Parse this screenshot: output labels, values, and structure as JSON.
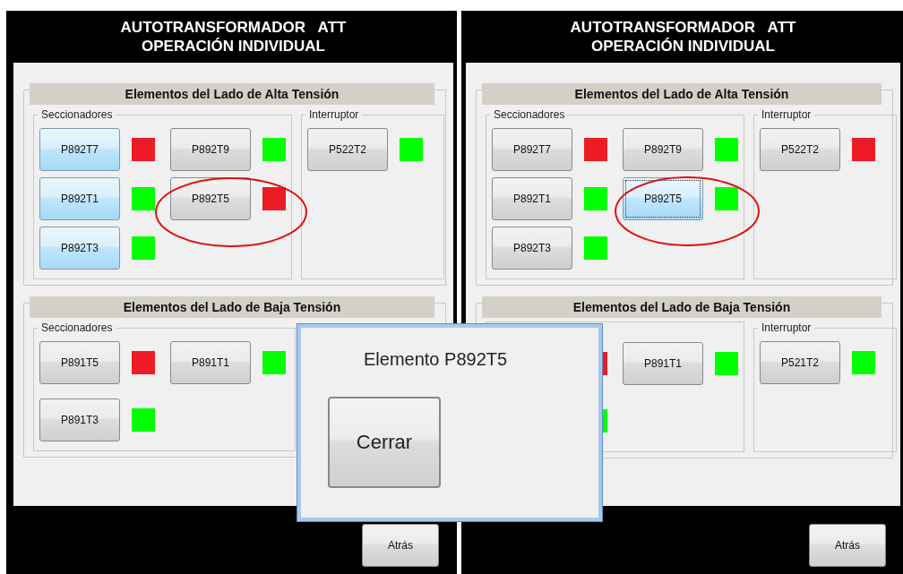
{
  "panels": [
    {
      "title_lines": [
        "AUTOTRANSFORMADOR   ATT",
        "OPERACIÓN INDIVIDUAL"
      ],
      "sections": [
        {
          "heading": "Elementos del Lado de Alta Tensión",
          "groups": [
            {
              "label": "Seccionadores",
              "items": [
                {
                  "label": "P892T7",
                  "highlighted": true,
                  "focused": false,
                  "color": "#ed1c24"
                },
                {
                  "label": "P892T9",
                  "highlighted": false,
                  "focused": false,
                  "color": "#00ff00"
                },
                {
                  "label": "P892T1",
                  "highlighted": true,
                  "focused": false,
                  "color": "#00ff00"
                },
                {
                  "label": "P892T5",
                  "highlighted": false,
                  "focused": false,
                  "color": "#ed1c24"
                },
                {
                  "label": "P892T3",
                  "highlighted": true,
                  "focused": false,
                  "color": "#00ff00"
                }
              ]
            },
            {
              "label": "Interruptor",
              "items": [
                {
                  "label": "P522T2",
                  "highlighted": false,
                  "focused": false,
                  "color": "#00ff00"
                }
              ]
            }
          ]
        },
        {
          "heading": "Elementos del Lado de Baja Tensión",
          "groups": [
            {
              "label": "Seccionadores",
              "items": [
                {
                  "label": "P891T5",
                  "highlighted": false,
                  "focused": false,
                  "color": "#ed1c24"
                },
                {
                  "label": "P891T1",
                  "highlighted": false,
                  "focused": false,
                  "color": "#00ff00"
                },
                {
                  "label": "P891T3",
                  "highlighted": false,
                  "focused": false,
                  "color": "#00ff00"
                }
              ]
            }
          ]
        }
      ],
      "back_button": "Atrás"
    },
    {
      "title_lines": [
        "AUTOTRANSFORMADOR   ATT",
        "OPERACIÓN INDIVIDUAL"
      ],
      "sections": [
        {
          "heading": "Elementos del Lado de Alta Tensión",
          "groups": [
            {
              "label": "Seccionadores",
              "items": [
                {
                  "label": "P892T7",
                  "highlighted": false,
                  "focused": false,
                  "color": "#ed1c24"
                },
                {
                  "label": "P892T9",
                  "highlighted": false,
                  "focused": false,
                  "color": "#00ff00"
                },
                {
                  "label": "P892T1",
                  "highlighted": false,
                  "focused": false,
                  "color": "#00ff00"
                },
                {
                  "label": "P892T5",
                  "highlighted": true,
                  "focused": true,
                  "color": "#00ff00"
                },
                {
                  "label": "P892T3",
                  "highlighted": false,
                  "focused": false,
                  "color": "#00ff00"
                }
              ]
            },
            {
              "label": "Interruptor",
              "items": [
                {
                  "label": "P522T2",
                  "highlighted": false,
                  "focused": false,
                  "color": "#ed1c24"
                }
              ]
            }
          ]
        },
        {
          "heading": "Elementos del Lado de Baja Tensión",
          "groups": [
            {
              "items": [
                {
                  "color": "#ed1c24"
                },
                {
                  "label": "P891T1",
                  "highlighted": false,
                  "focused": false,
                  "color": "#00ff00"
                },
                {
                  "color": "#00ff00"
                }
              ]
            },
            {
              "label": "Interruptor",
              "items": [
                {
                  "label": "P521T2",
                  "highlighted": false,
                  "focused": false,
                  "color": "#00ff00"
                }
              ]
            }
          ]
        }
      ],
      "back_button": "Atrás"
    }
  ],
  "dialog": {
    "message": "Elemento P892T5",
    "button": "Cerrar"
  }
}
